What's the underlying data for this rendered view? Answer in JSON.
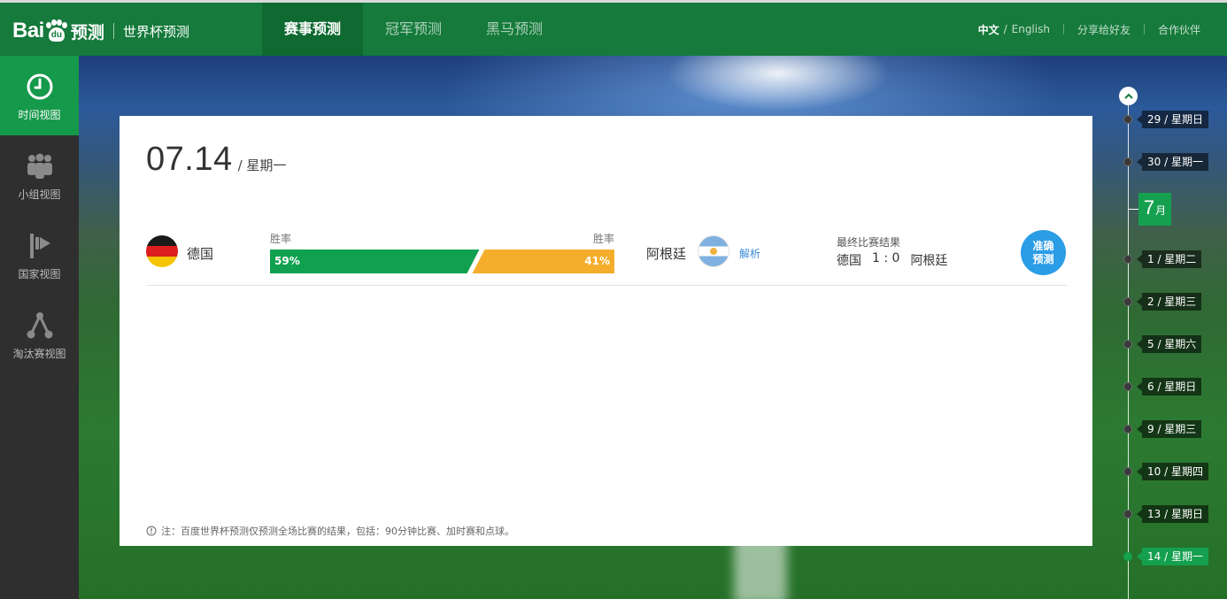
{
  "header": {
    "logo_bai": "Bai",
    "logo_du": "du",
    "logo_yuce": "预测",
    "logo_sub": "世界杯预测",
    "nav": [
      {
        "label": "赛事预测",
        "active": true
      },
      {
        "label": "冠军预测",
        "active": false
      },
      {
        "label": "黑马预测",
        "active": false
      }
    ],
    "lang_current": "中文",
    "lang_sep": "/",
    "lang_other": "English",
    "share": "分享给好友",
    "partner": "合作伙伴"
  },
  "sidebar": {
    "items": [
      {
        "label": "时间视图",
        "icon": "clock-icon",
        "active": true
      },
      {
        "label": "小组视图",
        "icon": "group-icon",
        "active": false
      },
      {
        "label": "国家视图",
        "icon": "flag-icon",
        "active": false
      },
      {
        "label": "淘汰赛视图",
        "icon": "bracket-icon",
        "active": false
      }
    ]
  },
  "card": {
    "date": "07.14",
    "weekday": "/ 星期一",
    "match": {
      "home": {
        "name": "德国",
        "win_rate_label": "胜率",
        "win_pct": "59%",
        "win_value": 59,
        "color": "#10a050"
      },
      "away": {
        "name": "阿根廷",
        "win_rate_label": "胜率",
        "win_pct": "41%",
        "win_value": 41,
        "color": "#f5ae2b"
      },
      "analysis": "解析",
      "result_title": "最终比赛结果",
      "result_home": "德国",
      "result_score": "1 : 0",
      "result_away": "阿根廷",
      "predict_line1": "准确",
      "predict_line2": "预测"
    },
    "note": "注：百度世界杯预测仅预测全场比赛的结果，包括：90分钟比赛、加时赛和点球。"
  },
  "timeline": {
    "month_num": "7",
    "month_unit": "月",
    "items": [
      {
        "label": "29 / 星期日",
        "active": false
      },
      {
        "label": "30 / 星期一",
        "active": false
      },
      {
        "label": "1 / 星期二",
        "active": false
      },
      {
        "label": "2 / 星期三",
        "active": false
      },
      {
        "label": "5 / 星期六",
        "active": false
      },
      {
        "label": "6 / 星期日",
        "active": false
      },
      {
        "label": "9 / 星期三",
        "active": false
      },
      {
        "label": "10 / 星期四",
        "active": false
      },
      {
        "label": "13 / 星期日",
        "active": false
      },
      {
        "label": "14 / 星期一",
        "active": true
      }
    ]
  },
  "colors": {
    "header_bg": "#157a3b",
    "accent_green": "#15a04f",
    "home_bar": "#10a050",
    "away_bar": "#f5ae2b",
    "predict_blue": "#2b9ce6"
  }
}
